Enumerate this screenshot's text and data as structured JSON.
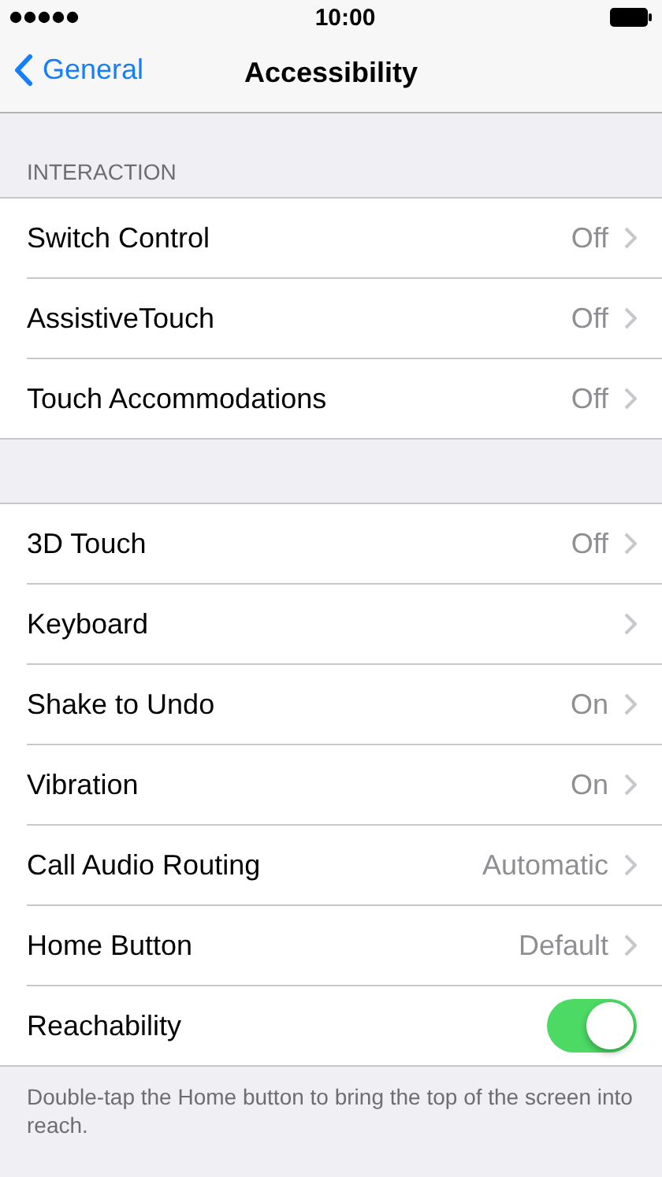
{
  "status_bar": {
    "time": "10:00"
  },
  "nav": {
    "back": "General",
    "title": "Accessibility"
  },
  "sections": [
    {
      "header": "INTERACTION",
      "rows": [
        {
          "kind": "disclosure",
          "label": "Switch Control",
          "value": "Off"
        },
        {
          "kind": "disclosure",
          "label": "AssistiveTouch",
          "value": "Off"
        },
        {
          "kind": "disclosure",
          "label": "Touch Accommodations",
          "value": "Off"
        }
      ]
    },
    {
      "rows": [
        {
          "kind": "disclosure",
          "label": "3D Touch",
          "value": "Off"
        },
        {
          "kind": "disclosure",
          "label": "Keyboard"
        },
        {
          "kind": "disclosure",
          "label": "Shake to Undo",
          "value": "On"
        },
        {
          "kind": "disclosure",
          "label": "Vibration",
          "value": "On"
        },
        {
          "kind": "disclosure",
          "label": "Call Audio Routing",
          "value": "Automatic"
        },
        {
          "kind": "disclosure",
          "label": "Home Button",
          "value": "Default"
        },
        {
          "kind": "toggle",
          "label": "Reachability",
          "on": true
        }
      ],
      "footer": "Double-tap the Home button to bring the top of the screen into reach."
    }
  ]
}
